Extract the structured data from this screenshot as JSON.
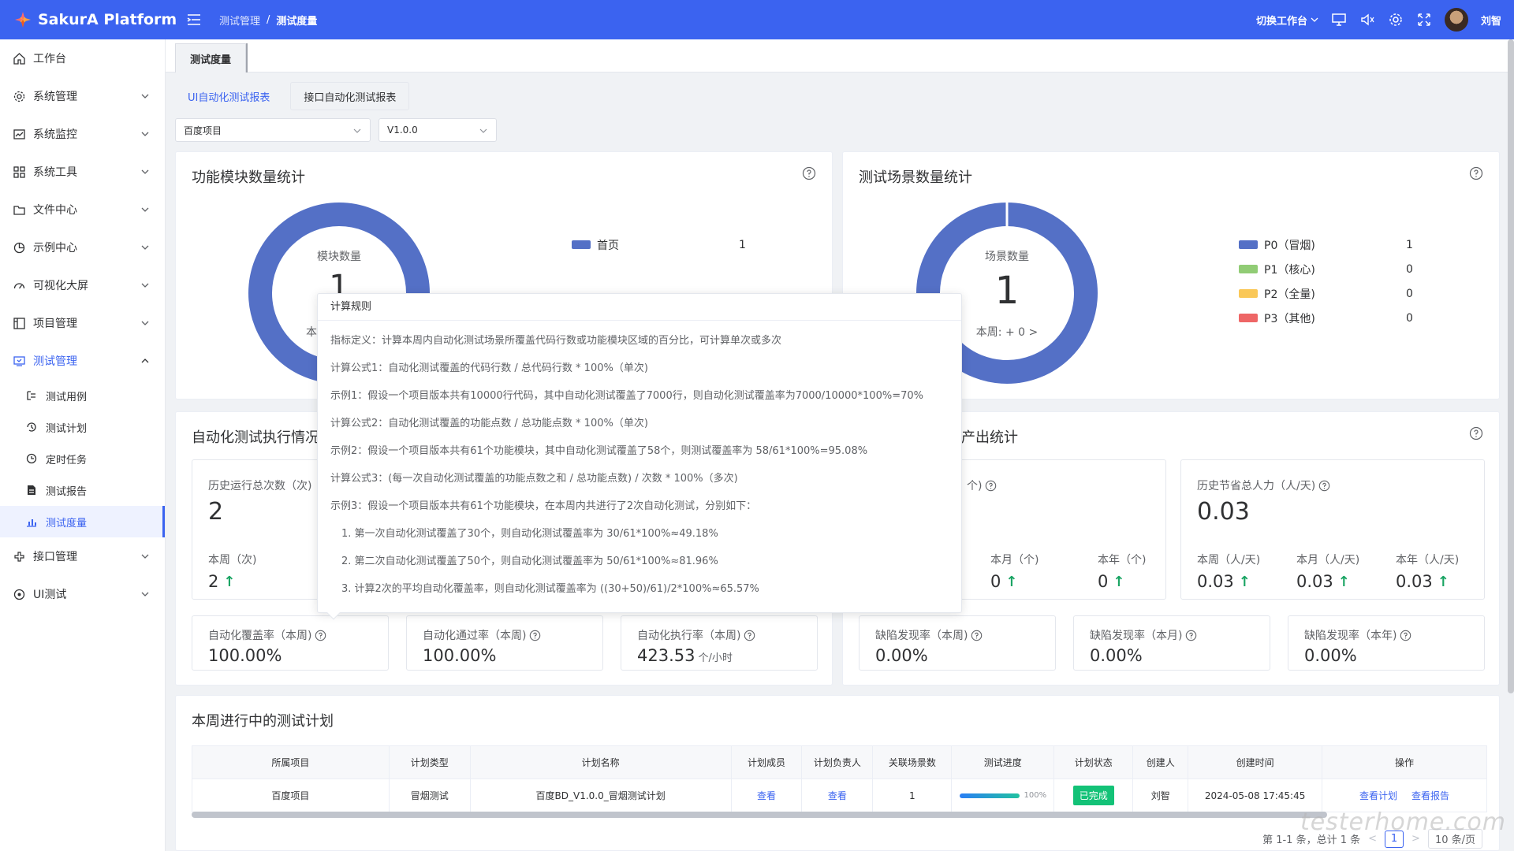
{
  "app": {
    "title": "SakurA Platform"
  },
  "breadcrumb": {
    "parent": "测试管理",
    "separator": "/",
    "current": "测试度量"
  },
  "topbar": {
    "workspace": "切换工作台",
    "username": "刘智"
  },
  "sidebar": {
    "items": [
      {
        "label": "工作台",
        "icon": "home-icon"
      },
      {
        "label": "系统管理",
        "icon": "gear-icon"
      },
      {
        "label": "系统监控",
        "icon": "monitor-chart-icon"
      },
      {
        "label": "系统工具",
        "icon": "grid-icon"
      },
      {
        "label": "文件中心",
        "icon": "folder-icon"
      },
      {
        "label": "示例中心",
        "icon": "pie-icon"
      },
      {
        "label": "可视化大屏",
        "icon": "dashboard-icon"
      },
      {
        "label": "项目管理",
        "icon": "project-icon"
      },
      {
        "label": "测试管理",
        "icon": "test-icon"
      }
    ],
    "sub_items": [
      {
        "label": "测试用例"
      },
      {
        "label": "测试计划"
      },
      {
        "label": "定时任务"
      },
      {
        "label": "测试报告"
      },
      {
        "label": "测试度量"
      }
    ],
    "bottom_items": [
      {
        "label": "接口管理"
      },
      {
        "label": "UI测试"
      }
    ]
  },
  "page_tab": {
    "label": "测试度量"
  },
  "subtabs": [
    "UI自动化测试报表",
    "接口自动化测试报表"
  ],
  "filters": {
    "project": "百度项目",
    "version": "V1.0.0"
  },
  "module_card": {
    "title": "功能模块数量统计",
    "center_label": "模块数量",
    "center_value": "1",
    "center_week": "本",
    "legend": [
      {
        "name": "首页",
        "value": "1",
        "color": "#5470c6"
      }
    ]
  },
  "scene_card": {
    "title": "测试场景数量统计",
    "center_label": "场景数量",
    "center_value": "1",
    "center_week": "本周: + 0 >",
    "legend": [
      {
        "name": "P0（冒烟)",
        "value": "1",
        "color": "#5470c6"
      },
      {
        "name": "P1（核心)",
        "value": "0",
        "color": "#91cc75"
      },
      {
        "name": "P2（全量)",
        "value": "0",
        "color": "#fac858"
      },
      {
        "name": "P3（其他)",
        "value": "0",
        "color": "#ee6666"
      }
    ]
  },
  "exec_card": {
    "title": "自动化测试执行情况",
    "history_label": "历史运行总次数（次)",
    "history_value": "2",
    "week_label": "本周（次)",
    "week_value": "2",
    "minis": [
      {
        "label": "自动化覆盖率（本周)",
        "value": "100.00%",
        "unit": ""
      },
      {
        "label": "自动化通过率（本周)",
        "value": "100.00%",
        "unit": ""
      },
      {
        "label": "自动化执行率（本周)",
        "value": "423.53",
        "unit": "个/小时"
      }
    ]
  },
  "output_card": {
    "title": "产出统计",
    "left_label": "个)",
    "month_label": "本月（个)",
    "month_value": "0",
    "year_label": "本年（个)",
    "year_value": "0",
    "saved_label": "历史节省总人力（人/天)",
    "saved_value": "0.03",
    "saved_week_label": "本周（人/天)",
    "saved_week_value": "0.03",
    "saved_month_label": "本月（人/天)",
    "saved_month_value": "0.03",
    "saved_year_label": "本年（人/天)",
    "saved_year_value": "0.03",
    "minis": [
      {
        "label": "缺陷发现率（本周)",
        "value": "0.00%"
      },
      {
        "label": "缺陷发现率（本月)",
        "value": "0.00%"
      },
      {
        "label": "缺陷发现率（本年)",
        "value": "0.00%"
      }
    ]
  },
  "popover": {
    "title": "计算规则",
    "lines": [
      "指标定义：计算本周内自动化测试场景所覆盖代码行数或功能模块区域的百分比，可计算单次或多次",
      "计算公式1：自动化测试覆盖的代码行数 / 总代码行数 * 100%（单次)",
      "示例1：假设一个项目版本共有10000行代码，其中自动化测试覆盖了7000行，则自动化测试覆盖率为7000/10000*100%=70%",
      "计算公式2：自动化测试覆盖的功能点数 / 总功能点数 * 100%（单次)",
      "示例2：假设一个项目版本共有61个功能模块，其中自动化测试覆盖了58个，则测试覆盖率为 58/61*100%=95.08%",
      "计算公式3：(每一次自动化测试覆盖的功能点数之和 / 总功能点数) / 次数 * 100%（多次)",
      "示例3：假设一个项目版本共有61个功能模块，在本周内共进行了2次自动化测试，分别如下：",
      "  1. 第一次自动化测试覆盖了30个，则自动化测试覆盖率为 30/61*100%≈49.18%",
      "  2. 第二次自动化测试覆盖了50个，则自动化测试覆盖率为 50/61*100%≈81.96%",
      "  3. 计算2次的平均自动化覆盖率，则自动化测试覆盖率为 ((30+50)/61)/2*100%≈65.57%"
    ]
  },
  "plan_card": {
    "title": "本周进行中的测试计划",
    "columns": [
      "所属项目",
      "计划类型",
      "计划名称",
      "计划成员",
      "计划负责人",
      "关联场景数",
      "测试进度",
      "计划状态",
      "创建人",
      "创建时间",
      "操作"
    ],
    "rows": [
      {
        "project": "百度项目",
        "type": "冒烟测试",
        "name": "百度BD_V1.0.0_冒烟测试计划",
        "members": "查看",
        "owner": "查看",
        "scenes": "1",
        "progress": "100%",
        "progress_value": 100,
        "status": "已完成",
        "creator": "刘智",
        "created": "2024-05-08 17:45:45",
        "op1": "查看计划",
        "op2": "查看报告"
      }
    ],
    "pager": {
      "total": "第 1-1 条，总计 1 条",
      "page": "1",
      "size": "10 条/页",
      "prev": "<",
      "next": ">"
    }
  },
  "watermark": "testerhome.com",
  "colors": {
    "primary": "#3b63f0",
    "donut": "#5470c6",
    "success": "#13c277"
  }
}
